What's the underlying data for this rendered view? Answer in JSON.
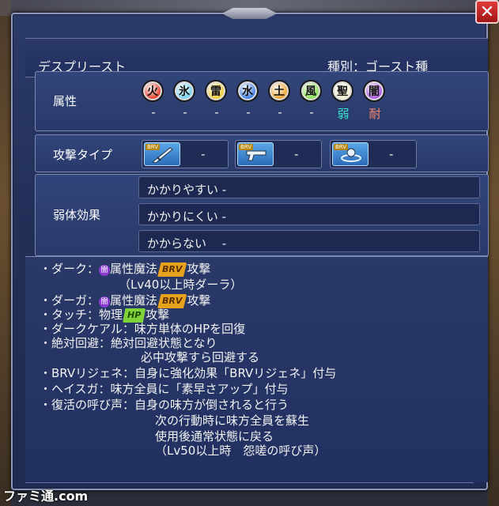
{
  "header": {
    "name": "デスプリースト",
    "type_label": "種別：ゴースト種"
  },
  "attributes": {
    "label": "属性",
    "items": [
      {
        "char": "火",
        "value": "-",
        "color": "#e84a3a"
      },
      {
        "char": "氷",
        "value": "-",
        "color": "#7fd4f0"
      },
      {
        "char": "雷",
        "value": "-",
        "color": "#f4d040"
      },
      {
        "char": "水",
        "value": "-",
        "color": "#4a86e8"
      },
      {
        "char": "土",
        "value": "-",
        "color": "#f0a83a"
      },
      {
        "char": "風",
        "value": "-",
        "color": "#8ee05a"
      },
      {
        "char": "聖",
        "value": "弱",
        "color": "#f4f0d0"
      },
      {
        "char": "闇",
        "value": "耐",
        "color": "#b060e0"
      }
    ]
  },
  "attack": {
    "label": "攻撃タイプ",
    "tiles": [
      {
        "icon": "sword-icon",
        "brv": "BRV",
        "value": "-"
      },
      {
        "icon": "gun-icon",
        "brv": "BRV",
        "value": "-"
      },
      {
        "icon": "magic-icon",
        "brv": "BRV",
        "value": "-"
      }
    ]
  },
  "debuff": {
    "label": "弱体効果",
    "rows": [
      {
        "text": "かかりやすい -"
      },
      {
        "text": "かかりにくい -"
      },
      {
        "text": "かからない　 -"
      }
    ]
  },
  "skills": {
    "dark_char": "闇",
    "brv": "BRV",
    "hp": "HP",
    "lines": {
      "l1a": "・ダーク：",
      "l1b": "属性魔法",
      "l1c": "攻撃",
      "l2": "（Lv40以上時ダーラ）",
      "l3a": "・ダーガ：",
      "l3b": "属性魔法",
      "l3c": "攻撃",
      "l4a": "・タッチ：物理",
      "l4b": "攻撃",
      "l5": "・ダークケアル：味方単体のHPを回復",
      "l6": "・絶対回避：絶対回避状態となり",
      "l7": "必中攻撃すら回避する",
      "l8": "・BRVリジェネ：自身に強化効果「BRVリジェネ」付与",
      "l9": "・ヘイスガ：味方全員に「素早さアップ」付与",
      "l10": "・復活の呼び声：自身の味方が倒されると行う",
      "l11": "次の行動時に味方全員を蘇生",
      "l12": "使用後通常状態に戻る",
      "l13": "（Lv50以上時　怨嗟の呼び声）"
    }
  },
  "close_label": "✕",
  "watermark": "ファミ通.com"
}
